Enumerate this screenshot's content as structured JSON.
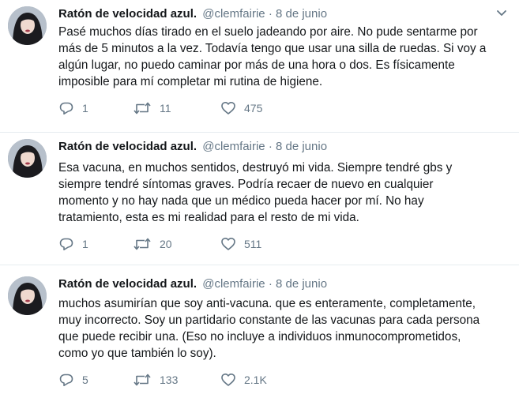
{
  "tweets": [
    {
      "name": "Ratón de velocidad azul.",
      "handle": "@clemfairie",
      "separator": "·",
      "date": "8 de junio",
      "lines": [
        "Pasé muchos días tirado en el suelo jadeando por aire. No pude sentarme por",
        "más de 5 minutos a la vez. Todavía tengo que usar una silla de ruedas. Si voy a",
        "algún lugar, no puedo caminar por más de una hora o dos. Es físicamente",
        "imposible para mí completar mi rutina de higiene."
      ],
      "replies": "1",
      "retweets": "11",
      "likes": "475"
    },
    {
      "name": "Ratón de velocidad azul.",
      "handle": "@clemfairie",
      "separator": "·",
      "date": "8 de junio",
      "lines": [
        "Esa vacuna, en muchos sentidos, destruyó mi vida. Siempre tendré gbs y",
        "siempre tendré síntomas graves. Podría recaer de nuevo en cualquier",
        "momento y no hay nada que un médico pueda hacer por mí. No hay",
        "tratamiento, esta es mi realidad para el resto de mi vida."
      ],
      "replies": "1",
      "retweets": "20",
      "likes": "511"
    },
    {
      "name": "Ratón de velocidad azul.",
      "handle": "@clemfairie",
      "separator": "·",
      "date": "8 de junio",
      "lines": [
        "muchos asumirían que soy anti-vacuna. que es enteramente, completamente,",
        "muy incorrecto. Soy un partidario constante de las vacunas para cada persona",
        "que puede recibir una. (Eso no incluye a individuos inmunocomprometidos,",
        "como yo que también lo soy)."
      ],
      "replies": "5",
      "retweets": "133",
      "likes": "2.1K"
    }
  ],
  "icons": {
    "reply": "reply-icon",
    "retweet": "retweet-icon",
    "like": "heart-icon",
    "caret": "chevron-down-icon",
    "avatar": "avatar"
  },
  "colors": {
    "text": "#14171a",
    "secondary": "#657786",
    "divider": "#e6ecf0"
  }
}
